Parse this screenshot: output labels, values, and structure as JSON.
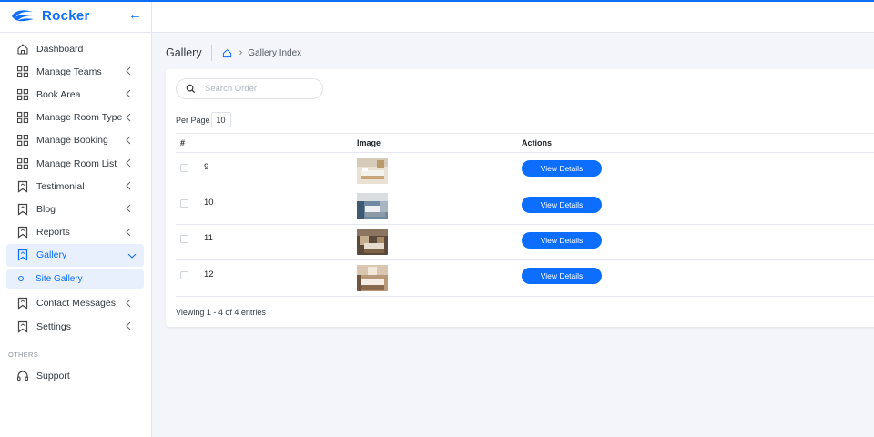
{
  "brand": {
    "name": "Rocker"
  },
  "sidebar": {
    "items": [
      {
        "label": "Dashboard",
        "icon": "home-icon",
        "has_children": false
      },
      {
        "label": "Manage Teams",
        "icon": "grid-icon",
        "has_children": true
      },
      {
        "label": "Book Area",
        "icon": "grid-icon",
        "has_children": true
      },
      {
        "label": "Manage Room Type",
        "icon": "grid-icon",
        "has_children": true
      },
      {
        "label": "Manage Booking",
        "icon": "grid-icon",
        "has_children": true
      },
      {
        "label": "Manage Room List",
        "icon": "grid-icon",
        "has_children": true
      },
      {
        "label": "Testimonial",
        "icon": "bookmark-icon",
        "has_children": true
      },
      {
        "label": "Blog",
        "icon": "bookmark-icon",
        "has_children": true
      },
      {
        "label": "Reports",
        "icon": "bookmark-icon",
        "has_children": true
      },
      {
        "label": "Gallery",
        "icon": "bookmark-icon",
        "has_children": true,
        "expanded": true
      },
      {
        "label": "Contact Messages",
        "icon": "bookmark-icon",
        "has_children": true
      },
      {
        "label": "Settings",
        "icon": "bookmark-icon",
        "has_children": true
      }
    ],
    "gallery_sub": {
      "label": "Site Gallery"
    },
    "others_label": "OTHERS",
    "support": {
      "label": "Support",
      "icon": "headset-icon"
    }
  },
  "breadcrumb": {
    "title": "Gallery",
    "current": "Gallery Index"
  },
  "search": {
    "placeholder": "Search Order",
    "value": ""
  },
  "per_page": {
    "label": "Per Page",
    "value": "10"
  },
  "table": {
    "headers": [
      "#",
      "Image",
      "Actions"
    ],
    "rows": [
      {
        "id": "9",
        "action": "View Details"
      },
      {
        "id": "10",
        "action": "View Details"
      },
      {
        "id": "11",
        "action": "View Details"
      },
      {
        "id": "12",
        "action": "View Details"
      }
    ]
  },
  "footer": {
    "info": "Viewing 1 - 4 of 4 entries"
  },
  "colors": {
    "accent": "#0d6efd",
    "background": "#f4f5fb",
    "active_bg": "#e9f0fd"
  }
}
